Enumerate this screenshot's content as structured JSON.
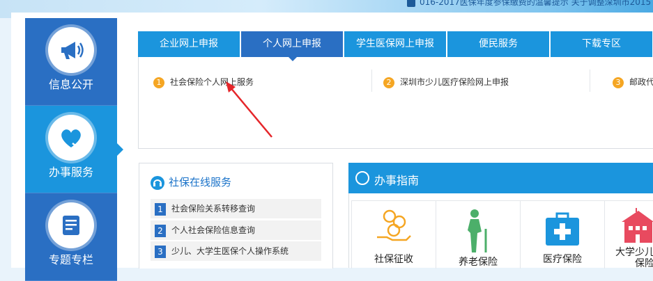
{
  "notice": {
    "text": "016-2017医保年度参保缴费的温馨提示  关于调整深圳市2015"
  },
  "left_nav": [
    {
      "label": "信息公开",
      "icon": "megaphone-icon"
    },
    {
      "label": "办事服务",
      "icon": "heart-hand-icon",
      "active": true
    },
    {
      "label": "专题专栏",
      "icon": "document-list-icon"
    }
  ],
  "tabs": [
    {
      "label": "企业网上申报"
    },
    {
      "label": "个人网上申报",
      "active": true
    },
    {
      "label": "学生医保网上申报"
    },
    {
      "label": "便民服务"
    },
    {
      "label": "下载专区"
    }
  ],
  "services": [
    {
      "num": "1",
      "label": "社会保险个人网上服务"
    },
    {
      "num": "2",
      "label": "深圳市少儿医疗保险网上申报"
    },
    {
      "num": "3",
      "label": "邮政代"
    }
  ],
  "online": {
    "title": "社保在线服务",
    "rows": [
      {
        "num": "1",
        "label": "社会保险关系转移查询"
      },
      {
        "num": "2",
        "label": "个人社会保险信息查询"
      },
      {
        "num": "3",
        "label": "少儿、大学生医保个人操作系统"
      }
    ]
  },
  "guide": {
    "title": "办事指南",
    "items": [
      {
        "label": "社保征收",
        "icon": "coin-hand-icon"
      },
      {
        "label": "养老保险",
        "icon": "elderly-icon"
      },
      {
        "label": "医疗保险",
        "icon": "medical-kit-icon"
      },
      {
        "label": "大学少儿",
        "label2": "保险",
        "icon": "school-building-icon"
      }
    ]
  },
  "colors": {
    "nav_blue": "#2a6fc3",
    "nav_active": "#1b95dd",
    "number_orange": "#f5a623",
    "arrow_red": "#e5262a"
  }
}
